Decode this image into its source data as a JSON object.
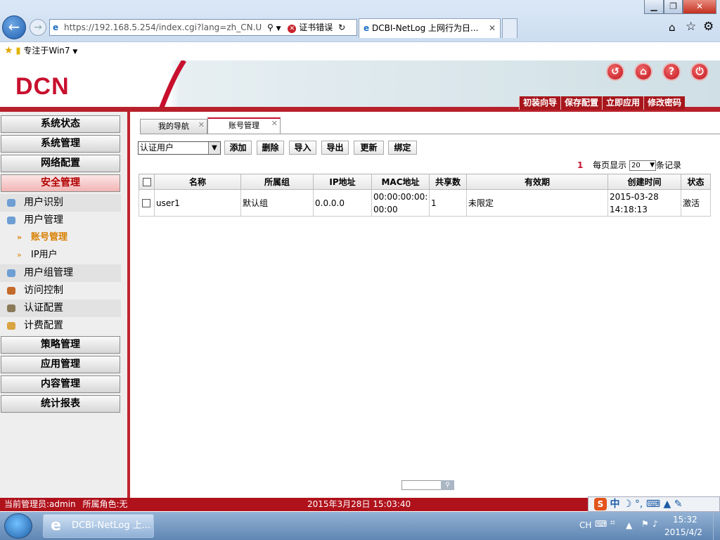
{
  "browser": {
    "address": "https://192.168.5.254/index.cgi?lang=zh_CN.U",
    "cert_error": "证书错误",
    "tab_title": "DCBI-NetLog 上网行为日...",
    "favorites": "专注于Win7"
  },
  "app": {
    "logo": "DCN",
    "top_buttons": [
      "初装向导",
      "保存配置",
      "立即应用",
      "修改密码"
    ]
  },
  "sidebar": {
    "items_top": [
      "系统状态",
      "系统管理",
      "网络配置",
      "安全管理"
    ],
    "sub_items": [
      "用户识别",
      "用户管理",
      "用户组管理",
      "访问控制",
      "认证配置",
      "计费配置"
    ],
    "user_sub": [
      "账号管理",
      "IP用户"
    ],
    "items_bottom": [
      "策略管理",
      "应用管理",
      "内容管理",
      "统计报表"
    ]
  },
  "content": {
    "tabs": [
      "我的导航",
      "账号管理"
    ],
    "filter_value": "认证用户",
    "buttons": [
      "添加",
      "删除",
      "导入",
      "导出",
      "更新",
      "绑定"
    ],
    "page_number": "1",
    "per_page_label": "每页显示",
    "per_page_value": "20",
    "records_label": "条记录",
    "columns": [
      "名称",
      "所属组",
      "IP地址",
      "MAC地址",
      "共享数",
      "有效期",
      "创建时间",
      "状态"
    ],
    "rows": [
      {
        "name": "user1",
        "group": "默认组",
        "ip": "0.0.0.0",
        "mac": "00:00:00:00:00:00",
        "share": "1",
        "validity": "未限定",
        "created": "2015-03-28 14:18:13",
        "status": "激活"
      }
    ]
  },
  "status_bar": {
    "admin": "当前管理员:admin",
    "role": "所属角色:无",
    "datetime": "2015年3月28日 15:03:40"
  },
  "taskbar": {
    "app_label": "DCBI-NetLog 上...",
    "lang": "CH",
    "time": "15:32",
    "date": "2015/4/2",
    "ime_label": "中"
  }
}
